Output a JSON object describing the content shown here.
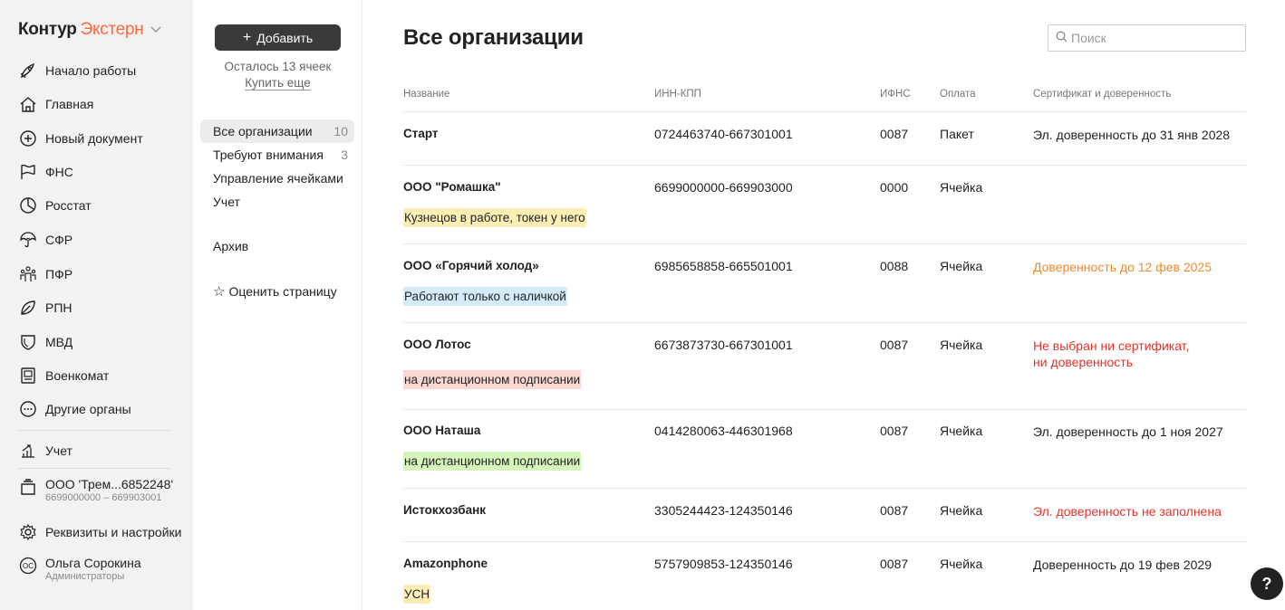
{
  "sidebar": {
    "logo_part1": "Контур",
    "logo_part2": "Экстерн",
    "items": [
      {
        "label": "Начало работы"
      },
      {
        "label": "Главная"
      },
      {
        "label": "Новый документ"
      },
      {
        "label": "ФНС"
      },
      {
        "label": "Росстат"
      },
      {
        "label": "СФР"
      },
      {
        "label": "ПФР"
      },
      {
        "label": "РПН"
      },
      {
        "label": "МВД"
      },
      {
        "label": "Военкомат"
      },
      {
        "label": "Другие органы"
      }
    ],
    "accounting_label": "Учет",
    "org": {
      "label": "ООО 'Трем...6852248'",
      "sub": "6699000000 – 669903001"
    },
    "settings_label": "Реквизиты и настройки",
    "user": {
      "name": "Ольга Сорокина",
      "role": "Администраторы",
      "initials": "ОС"
    }
  },
  "mid": {
    "add_label": "Добавить",
    "cells_left": "Осталось 13 ячеек",
    "buy_more": "Купить еще",
    "filters": [
      {
        "label": "Все организации",
        "count": "10"
      },
      {
        "label": "Требуют внимания",
        "count": "3"
      },
      {
        "label": "Управление ячейками",
        "count": ""
      },
      {
        "label": "Учет",
        "count": ""
      },
      {
        "label": "Архив",
        "count": ""
      }
    ],
    "rate_label": "Оценить страницу"
  },
  "main": {
    "title": "Все организации",
    "search_placeholder": "Поиск",
    "columns": {
      "name": "Название",
      "inn": "ИНН-КПП",
      "ifns": "ИФНС",
      "payment": "Оплата",
      "cert": "Сертификат и доверенность"
    },
    "rows": [
      {
        "name": "Старт",
        "inn": "0724463740-667301001",
        "ifns": "0087",
        "payment": "Пакет",
        "cert": [
          "Эл. доверенность до 31 янв 2028"
        ],
        "note": ""
      },
      {
        "name": "ООО \"Ромашка\"",
        "inn": "6699000000-669903000",
        "ifns": "0000",
        "payment": "Ячейка",
        "cert": [],
        "note": "Кузнецов в работе, токен у него"
      },
      {
        "name": "ООО «Горячий холод»",
        "inn": "6985658858-665501001",
        "ifns": "0088",
        "payment": "Ячейка",
        "cert": [
          "Доверенность до 12 фев 2025"
        ],
        "note": "Работают только с наличкой"
      },
      {
        "name": "ООО Лотос",
        "inn": "6673873730-667301001",
        "ifns": "0087",
        "payment": "Ячейка",
        "cert": [
          "Не выбран ни сертификат,",
          "ни доверенность"
        ],
        "note": "на дистанционном подписании"
      },
      {
        "name": "ООО Наташа",
        "inn": "0414280063-446301968",
        "ifns": "0087",
        "payment": "Ячейка",
        "cert": [
          "Эл. доверенность до 1 ноя 2027"
        ],
        "note": "на дистанционном подписании"
      },
      {
        "name": "Истокхозбанк",
        "inn": "3305244423-124350146",
        "ifns": "0087",
        "payment": "Ячейка",
        "cert": [
          "Эл. доверенность не заполнена"
        ],
        "note": ""
      },
      {
        "name": "Amazonphone",
        "inn": "5757909853-124350146",
        "ifns": "0087",
        "payment": "Ячейка",
        "cert": [
          "Доверенность до 19 фев 2029"
        ],
        "note": "УСН"
      }
    ]
  },
  "colors": {
    "brand": "#ff6a3d",
    "cert_warning": "#f08a2c",
    "cert_error": "#e5332a",
    "note_yellow": "#fdeeb5",
    "note_blue": "#d4ecfa",
    "note_pink": "#fbd8d3",
    "note_green": "#d5f5bb"
  },
  "help_label": "?"
}
